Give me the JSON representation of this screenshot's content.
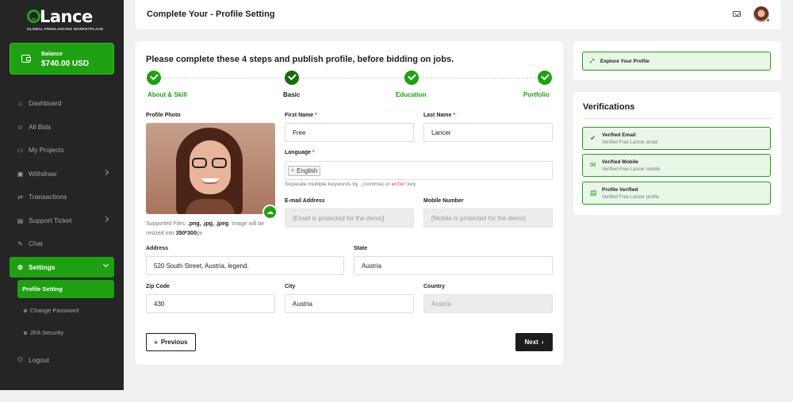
{
  "brand": {
    "name": "Lance",
    "tagline": "GLOBAL FREELANCING MARKETPLACE"
  },
  "balance": {
    "label": "Balance",
    "amount": "$740.00 USD"
  },
  "sidebar": {
    "items": [
      {
        "label": "Dashboard",
        "icon": "home-icon"
      },
      {
        "label": "All Bids",
        "icon": "users-icon"
      },
      {
        "label": "My Projects",
        "icon": "folder-icon"
      },
      {
        "label": "Withdraw",
        "icon": "wallet-icon"
      },
      {
        "label": "Transactions",
        "icon": "exchange-icon"
      },
      {
        "label": "Support Ticket",
        "icon": "ticket-icon"
      },
      {
        "label": "Chat",
        "icon": "chat-icon"
      },
      {
        "label": "Settings",
        "icon": "gear-icon"
      }
    ],
    "sub_items": [
      {
        "label": "Profile Setting"
      },
      {
        "label": "Change Password"
      },
      {
        "label": "2FA Security"
      }
    ],
    "logout": {
      "label": "Logout",
      "icon": "logout-icon"
    }
  },
  "header": {
    "title": "Complete Your - Profile Setting"
  },
  "main": {
    "heading": "Please complete these 4 steps and publish profile, before bidding on jobs.",
    "steps": [
      {
        "label": "About & Skill"
      },
      {
        "label": "Basic"
      },
      {
        "label": "Education"
      },
      {
        "label": "Portfolio"
      }
    ],
    "photo_label": "Profile Photo",
    "supported_prefix": "Supported Files: ",
    "supported_types": ".png, .jpg, .jpeg",
    "supported_mid": ". Image will be resized into ",
    "supported_size": "350*300",
    "supported_unit": "px",
    "fields": {
      "first_name": {
        "label": "First Name",
        "value": "Free"
      },
      "last_name": {
        "label": "Last Name",
        "value": "Lancer"
      },
      "language": {
        "label": "Language",
        "chip": "English"
      },
      "hint_prefix": "Separate multiple keywords by ",
      "hint_code1": ",",
      "hint_mid": "(comma) or ",
      "hint_code2": "enter",
      "hint_suffix": " key.",
      "email": {
        "label": "E-mail Address",
        "placeholder": "[Email is protected for the demo]"
      },
      "mobile": {
        "label": "Mobile Number",
        "placeholder": "[Mobile is protected for the demo]"
      },
      "address": {
        "label": "Address",
        "value": "520 South Street, Austria, legend."
      },
      "state": {
        "label": "State",
        "value": "Austria"
      },
      "zip": {
        "label": "Zip Code",
        "value": "430"
      },
      "city": {
        "label": "City",
        "value": "Austria"
      },
      "country": {
        "label": "Country",
        "placeholder": "Austria"
      }
    },
    "prev_label": "Previous",
    "next_label": "Next"
  },
  "explore": {
    "label": "Explore Your Profile"
  },
  "verifications": {
    "title": "Verifications",
    "items": [
      {
        "title": "Verified Email",
        "sub": "Verified Free Lancer email"
      },
      {
        "title": "Verified Mobile",
        "sub": "Verified Free Lancer mobile"
      },
      {
        "title": "Profile Verified",
        "sub": "Verified Free Lancer profile"
      }
    ]
  },
  "colors": {
    "accent": "#1fa012",
    "sidebar_bg": "#252525",
    "page_bg": "#f0f1f0"
  }
}
